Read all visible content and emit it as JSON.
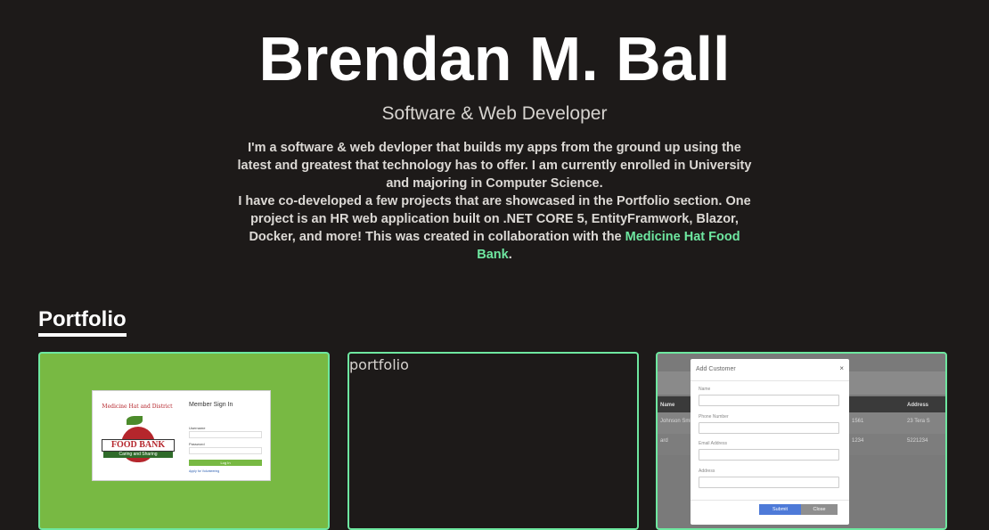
{
  "hero": {
    "name": "Brendan M. Ball",
    "subtitle": "Software & Web Developer",
    "bio_part1": "I'm a software & web devloper that builds my apps from the ground up using the latest and greatest that technology has to offer. I am currently enrolled in University and majoring in Computer Science.",
    "bio_part2": "I have co-developed a few projects that are showcased in the Portfolio section. One project is an HR web application built on .NET CORE 5, EntityFramwork, Blazor, Docker, and more! This was created in collaboration with the ",
    "bio_link": "Medicine Hat Food Bank",
    "bio_end": "."
  },
  "portfolio": {
    "heading": "Portfolio",
    "accent_color": "#6ee7a0",
    "cards": [
      {
        "type": "image",
        "login_preview": {
          "logo_arc": "Medicine Hat and District",
          "logo_main": "FOOD BANK",
          "logo_sub": "Caring and Sharing",
          "title": "Member Sign In",
          "username_label": "Username",
          "password_label": "Password",
          "button": "Log In",
          "link": "Apply for Volunteering"
        }
      },
      {
        "type": "broken-image",
        "alt_text": "portfolio"
      },
      {
        "type": "image",
        "table_headers": [
          "Name",
          "Address"
        ],
        "rows": [
          {
            "name": "Johnson Smit",
            "phone": "1561",
            "address": "23 Tera S"
          },
          {
            "name": "ard",
            "phone": "1234",
            "address": "5221234"
          }
        ],
        "modal": {
          "title": "Add Customer",
          "close": "×",
          "fields": [
            "Name",
            "Phone Number",
            "Email Address",
            "Address"
          ],
          "submit": "Submit",
          "cancel": "Close"
        }
      }
    ]
  }
}
